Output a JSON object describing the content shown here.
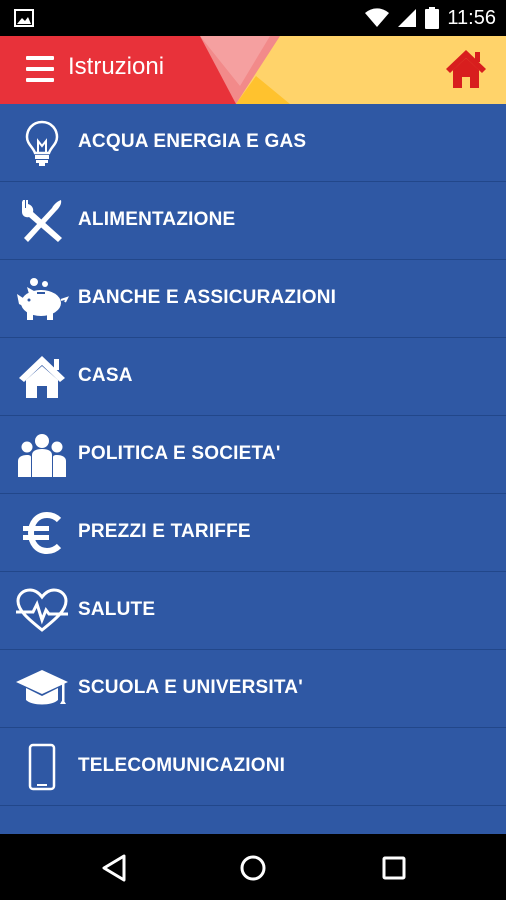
{
  "status_bar": {
    "time": "11:56",
    "icons": [
      "image-icon",
      "wifi-icon",
      "signal-icon",
      "battery-icon"
    ]
  },
  "app_bar": {
    "title": "Istruzioni",
    "menu_icon": "hamburger-icon",
    "home_icon": "home-icon",
    "colors": {
      "red": "#e8323a",
      "pink": "#f07a7a",
      "yellow": "#ffd36a",
      "orange": "#ffc22e",
      "home": "#d81e1e"
    }
  },
  "categories": [
    {
      "label": "ACQUA ENERGIA E GAS",
      "icon": "lightbulb-icon"
    },
    {
      "label": "ALIMENTAZIONE",
      "icon": "fork-knife-icon"
    },
    {
      "label": "BANCHE E ASSICURAZIONI",
      "icon": "piggy-bank-icon"
    },
    {
      "label": "CASA",
      "icon": "house-icon"
    },
    {
      "label": "POLITICA E SOCIETA'",
      "icon": "people-icon"
    },
    {
      "label": "PREZZI E TARIFFE",
      "icon": "euro-icon"
    },
    {
      "label": "SALUTE",
      "icon": "heart-pulse-icon"
    },
    {
      "label": "SCUOLA E UNIVERSITA'",
      "icon": "graduation-cap-icon"
    },
    {
      "label": "TELECOMUNICAZIONI",
      "icon": "smartphone-icon"
    }
  ],
  "list_color": "#2f58a4",
  "nav_bar": {
    "icons": [
      "back-icon",
      "home-circle-icon",
      "recents-icon"
    ]
  }
}
